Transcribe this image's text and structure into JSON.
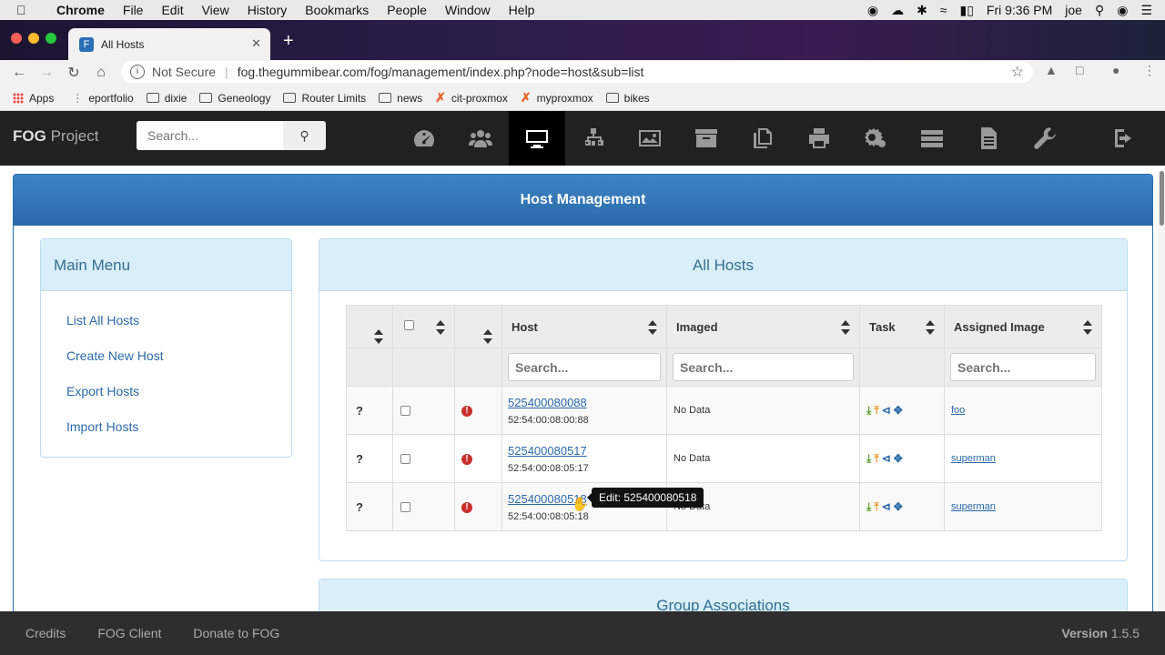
{
  "macbar": {
    "app": "Chrome",
    "menus": [
      "File",
      "Edit",
      "View",
      "History",
      "Bookmarks",
      "People",
      "Window",
      "Help"
    ],
    "clock": "Fri 9:36 PM",
    "user": "joe"
  },
  "tab": {
    "title": "All Hosts",
    "favicon": "F"
  },
  "address": {
    "security": "Not Secure",
    "url": "fog.thegummibear.com/fog/management/index.php?node=host&sub=list"
  },
  "bookmarks": [
    {
      "label": "Apps",
      "icon": "apps-grid-icon"
    },
    {
      "label": "eportfolio",
      "icon": "dots-icon"
    },
    {
      "label": "dixie",
      "icon": "folder-icon"
    },
    {
      "label": "Geneology",
      "icon": "folder-icon"
    },
    {
      "label": "Router Limits",
      "icon": "router-icon"
    },
    {
      "label": "news",
      "icon": "folder-icon"
    },
    {
      "label": "cit-proxmox",
      "icon": "proxmox-icon"
    },
    {
      "label": "myproxmox",
      "icon": "proxmox-icon"
    },
    {
      "label": "bikes",
      "icon": "folder-icon"
    }
  ],
  "header": {
    "logo_bold": "FOG",
    "logo_light": "Project",
    "search_placeholder": "Search...",
    "nav_icons": [
      "dashboard-icon",
      "users-icon",
      "hosts-icon",
      "groups-icon",
      "images-icon",
      "storage-icon",
      "snapins-icon",
      "printers-icon",
      "service-icon",
      "tasks-icon",
      "reports-icon",
      "settings-icon",
      "logout-icon"
    ]
  },
  "page": {
    "title": "Host Management",
    "menu": {
      "title": "Main Menu",
      "items": [
        "List All Hosts",
        "Create New Host",
        "Export Hosts",
        "Import Hosts"
      ]
    },
    "hosts_panel_title": "All Hosts",
    "group_panel_title": "Group Associations",
    "table": {
      "headers": [
        "",
        "",
        "",
        "Host",
        "Imaged",
        "Task",
        "Assigned Image"
      ],
      "search_placeholder": "Search...",
      "rows": [
        {
          "status": "?",
          "host": "525400080088",
          "mac": "52:54:00:08:00:88",
          "imaged": "No Data",
          "image": "foo"
        },
        {
          "status": "?",
          "host": "525400080517",
          "mac": "52:54:00:08:05:17",
          "imaged": "No Data",
          "image": "superman"
        },
        {
          "status": "?",
          "host": "525400080518",
          "mac": "52:54:00:08:05:18",
          "imaged": "No Data",
          "image": "superman"
        }
      ]
    },
    "tooltip": "Edit: 525400080518"
  },
  "footer": {
    "links": [
      "Credits",
      "FOG Client",
      "Donate to FOG"
    ],
    "version_label": "Version",
    "version": "1.5.5"
  },
  "colors": {
    "header_bg": "#212121",
    "panel_blue": "#2a6aaa",
    "panel_light": "#d9eef9",
    "warn_red": "#c9302c"
  }
}
